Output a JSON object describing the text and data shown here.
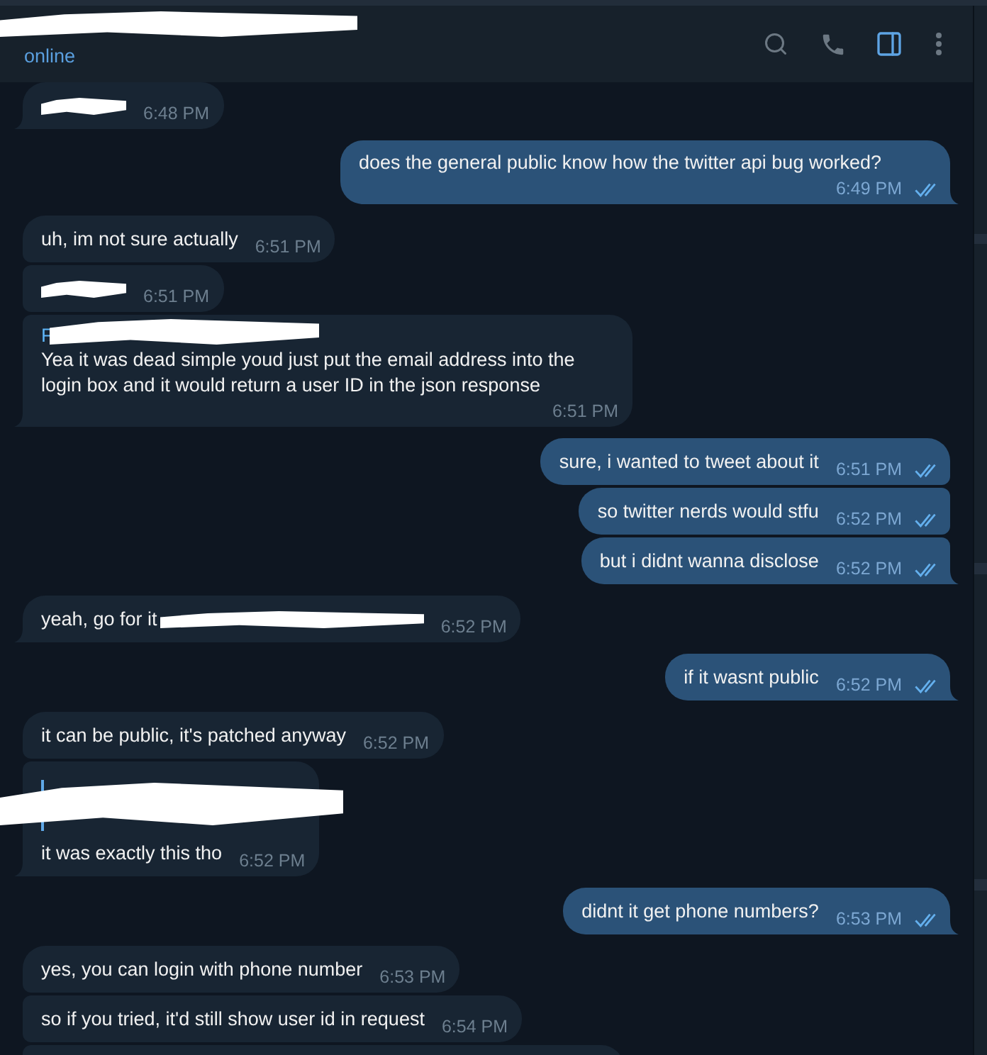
{
  "header": {
    "title_redacted": true,
    "status": "online",
    "actions": [
      {
        "kind": "search",
        "active": false
      },
      {
        "kind": "call",
        "active": false
      },
      {
        "kind": "panel",
        "active": true
      },
      {
        "kind": "more",
        "active": false
      }
    ]
  },
  "messages": [
    {
      "kind": "incoming",
      "text_redacted": true,
      "time": "6:48 PM"
    },
    {
      "kind": "outgoing",
      "text": "does the general public know how the twitter api bug worked?",
      "time": "6:49 PM",
      "read": true
    },
    {
      "kind": "incoming",
      "text": "uh, im not sure actually",
      "time": "6:51 PM"
    },
    {
      "kind": "incoming",
      "text_redacted": true,
      "time": "6:51 PM"
    },
    {
      "kind": "incoming",
      "forward_label": "F",
      "forward_redacted": true,
      "text": "Yea it was dead simple youd just put the email address into the login box and it would return a user ID in the json response",
      "time": "6:51 PM"
    },
    {
      "kind": "outgoing",
      "text": "sure, i wanted to tweet about it",
      "time": "6:51 PM",
      "read": true
    },
    {
      "kind": "outgoing",
      "text": "so twitter nerds would stfu",
      "time": "6:52 PM",
      "read": true
    },
    {
      "kind": "outgoing",
      "text": "but i didnt wanna disclose",
      "time": "6:52 PM",
      "read": true
    },
    {
      "kind": "incoming",
      "text": "yeah, go for it",
      "tail_redacted": true,
      "time": "6:52 PM"
    },
    {
      "kind": "outgoing",
      "text": "if it wasnt public",
      "time": "6:52 PM",
      "read": true
    },
    {
      "kind": "incoming",
      "text": "it can be public, it's patched anyway",
      "time": "6:52 PM"
    },
    {
      "kind": "incoming",
      "reply_redacted": true,
      "text": "it was exactly this tho",
      "time": "6:52 PM"
    },
    {
      "kind": "outgoing",
      "text": "didnt it get phone numbers?",
      "time": "6:53 PM",
      "read": true
    },
    {
      "kind": "incoming",
      "text": "yes, you can login with phone number",
      "time": "6:53 PM"
    },
    {
      "kind": "incoming",
      "text": "so if you tried, it'd still show user id in request",
      "time": "6:54 PM"
    },
    {
      "kind": "incoming"
    }
  ]
}
